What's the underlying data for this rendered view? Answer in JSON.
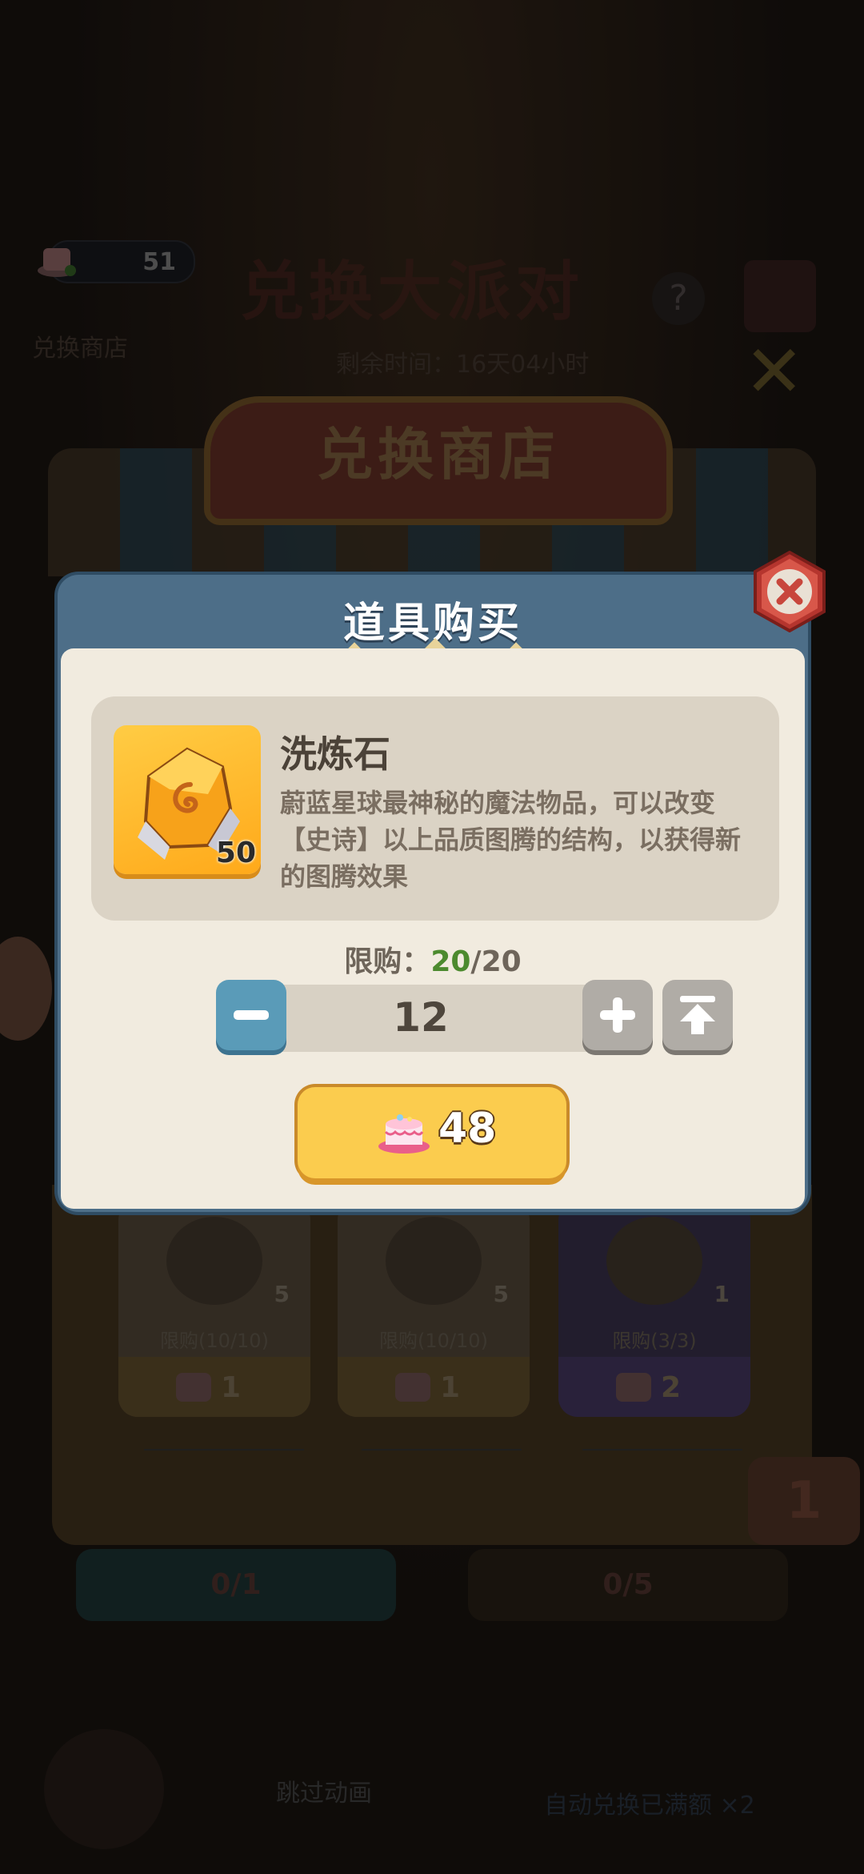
{
  "background": {
    "currency_value": "51",
    "event_title": "兑换大派对",
    "shop_sub": "兑换商店",
    "time_label": "剩余时间：16天04小时",
    "shop_sign": "兑换商店",
    "cards": [
      {
        "count": "5",
        "limit": "限购(10/10)",
        "cost": "1"
      },
      {
        "count": "5",
        "limit": "限购(10/10)",
        "cost": "1"
      },
      {
        "count": "1",
        "limit": "限购(3/3)",
        "cost": "2"
      }
    ],
    "badge": "1",
    "footer_left": "0/1",
    "footer_right": "0/5",
    "skip_text": "跳过动画",
    "auto_text": "自动兑换已满额 ×2"
  },
  "modal": {
    "title": "道具购买",
    "item": {
      "name": "洗炼石",
      "quantity": "50",
      "description": "蔚蓝星球最神秘的魔法物品，可以改变【史诗】以上品质图腾的结构，以获得新的图腾效果"
    },
    "limit": {
      "label": "限购：",
      "current": "20",
      "separator": "/",
      "max": "20"
    },
    "quantity": "12",
    "buy_price": "48"
  },
  "colors": {
    "modal_header": "#4d6e88",
    "modal_body": "#f1ebdf",
    "buy_button": "#fbcc4e",
    "limit_current": "#4c8a2e",
    "minus_button": "#5a9bb8",
    "close_button": "#c8463c"
  },
  "icons": [
    "cake-currency-icon",
    "orange-gem-icon",
    "close-icon",
    "minus-icon",
    "plus-icon",
    "max-arrow-icon"
  ]
}
